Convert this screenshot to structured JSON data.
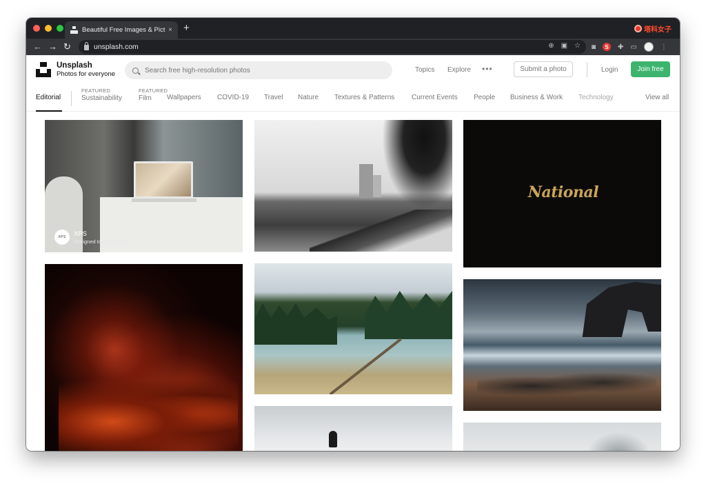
{
  "browser": {
    "tab_title": "Beautiful Free Images & Pictures",
    "tab_close": "×",
    "new_tab": "+",
    "url": "unsplash.com",
    "brand_tag": "塔科女子",
    "ext_s": "S"
  },
  "header": {
    "logo_name": "Unsplash",
    "logo_tagline": "Photos for everyone",
    "search_placeholder": "Search free high-resolution photos",
    "nav_topics": "Topics",
    "nav_explore": "Explore",
    "more": "•••",
    "submit_label": "Submit a photo",
    "login_label": "Login",
    "join_label": "Join free"
  },
  "topics": {
    "editorial": "Editorial",
    "featured_tag": "FEATURED",
    "sustainability": "Sustainability",
    "film": "Film",
    "wallpapers": "Wallpapers",
    "covid": "COVID-19",
    "travel": "Travel",
    "nature": "Nature",
    "textures": "Textures & Patterns",
    "current_events": "Current Events",
    "people": "People",
    "business": "Business & Work",
    "technology": "Technology",
    "view_all": "View all"
  },
  "sponsor": {
    "logo": "XPS",
    "name": "XPS",
    "subtitle": "Designed to be the Best ↗"
  },
  "national_logo": "National",
  "colors": {
    "join_green": "#3cb46e",
    "chrome_dark": "#202124",
    "chrome_tab": "#35363a"
  }
}
